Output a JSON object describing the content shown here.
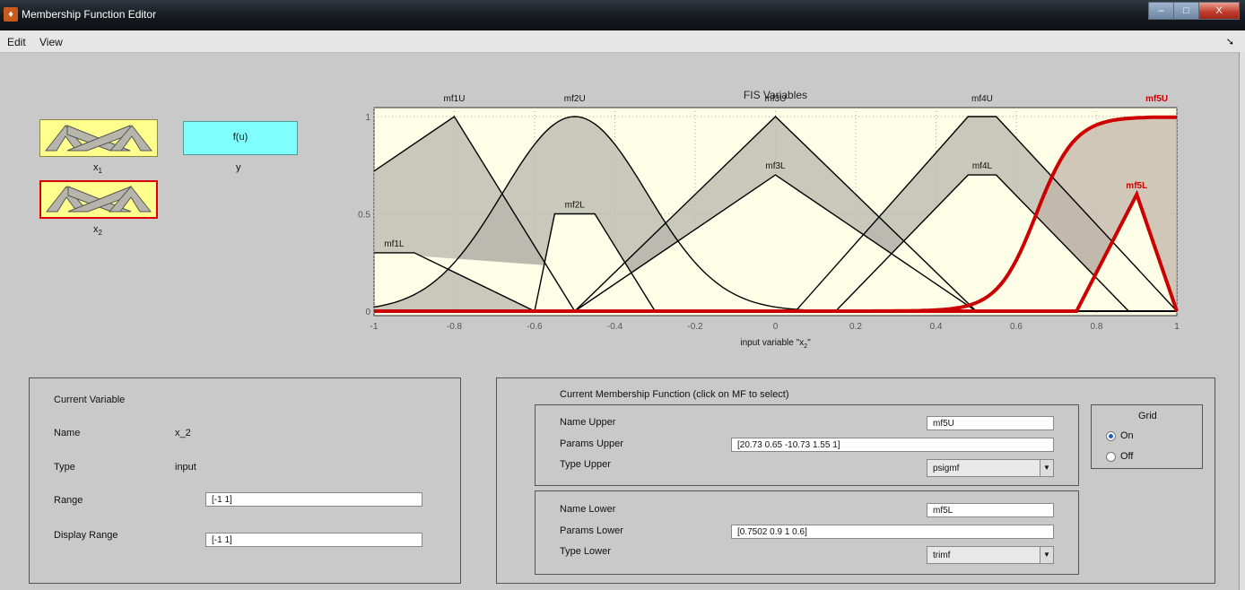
{
  "window": {
    "title": "Membership Function Editor",
    "minimize_label": "–",
    "maximize_label": "□",
    "close_label": "X"
  },
  "menu": {
    "edit": "Edit",
    "view": "View"
  },
  "fis_diagram": {
    "inputs": [
      {
        "name": "x",
        "subscript": "1"
      },
      {
        "name": "x",
        "subscript": "2"
      }
    ],
    "output": {
      "block_label": "f(u)",
      "name": "y"
    }
  },
  "plot": {
    "title": "FIS Variables",
    "xlabel_prefix": "input variable \"x",
    "xlabel_sub": "2",
    "xlabel_suffix": "\"",
    "xlim": [
      -1,
      1
    ],
    "ylim": [
      0,
      1
    ],
    "xticks": [
      "-1",
      "-0.8",
      "-0.6",
      "-0.4",
      "-0.2",
      "0",
      "0.2",
      "0.4",
      "0.6",
      "0.8",
      "1"
    ],
    "yticks": [
      "0",
      "0.5",
      "1"
    ],
    "grid": "on",
    "colors": {
      "background": "#ffffe8",
      "fill": "#b5b5ac",
      "line": "#000000",
      "selected": "#cc0000",
      "selected_fill": "#c0b4a8"
    }
  },
  "chart_data": {
    "type": "line",
    "title": "FIS Variables",
    "xlabel": "input variable \"x_2\"",
    "xlim": [
      -1,
      1
    ],
    "ylim": [
      0,
      1
    ],
    "grid": true,
    "series": [
      {
        "name": "mf1U",
        "points": [
          [
            -1,
            0.72
          ],
          [
            -0.8,
            1
          ],
          [
            -0.5,
            0
          ]
        ]
      },
      {
        "name": "mf1L",
        "points": [
          [
            -1,
            0.3
          ],
          [
            -0.9,
            0.3
          ],
          [
            -0.6,
            0
          ]
        ]
      },
      {
        "name": "mf2U",
        "shape": "gaussian",
        "center": -0.5,
        "sigma": 0.18,
        "peak": 1
      },
      {
        "name": "mf2L",
        "points": [
          [
            -0.6,
            0
          ],
          [
            -0.55,
            0.5
          ],
          [
            -0.45,
            0.5
          ],
          [
            -0.3,
            0
          ]
        ]
      },
      {
        "name": "mf3U",
        "points": [
          [
            -0.5,
            0
          ],
          [
            0,
            1
          ],
          [
            0.5,
            0
          ]
        ]
      },
      {
        "name": "mf3L",
        "points": [
          [
            -0.5,
            0
          ],
          [
            0,
            0.7
          ],
          [
            0.5,
            0
          ]
        ]
      },
      {
        "name": "mf4U",
        "points": [
          [
            0.05,
            0
          ],
          [
            0.48,
            1
          ],
          [
            0.55,
            1
          ],
          [
            1,
            0
          ]
        ]
      },
      {
        "name": "mf4L",
        "points": [
          [
            0.15,
            0
          ],
          [
            0.48,
            0.7
          ],
          [
            0.55,
            0.7
          ],
          [
            0.88,
            0
          ]
        ]
      },
      {
        "name": "mf5U",
        "shape": "psigmf",
        "params": [
          20.73,
          0.65,
          -10.73,
          1.55
        ],
        "selected": true
      },
      {
        "name": "mf5L",
        "points": [
          [
            0.7502,
            0
          ],
          [
            0.9,
            0.6
          ],
          [
            1,
            0
          ]
        ],
        "selected": true
      }
    ]
  },
  "current_variable": {
    "section_title": "Current Variable",
    "name_label": "Name",
    "name_value": "x_2",
    "type_label": "Type",
    "type_value": "input",
    "range_label": "Range",
    "range_value": "[-1 1]",
    "display_range_label": "Display Range",
    "display_range_value": "[-1 1]"
  },
  "current_mf": {
    "section_title": "Current Membership Function (click on MF to select)",
    "upper": {
      "name_label": "Name Upper",
      "name_value": "mf5U",
      "params_label": "Params Upper",
      "params_value": "[20.73 0.65 -10.73 1.55 1]",
      "type_label": "Type Upper",
      "type_value": "psigmf"
    },
    "lower": {
      "name_label": "Name Lower",
      "name_value": "mf5L",
      "params_label": "Params Lower",
      "params_value": "[0.7502 0.9 1 0.6]",
      "type_label": "Type Lower",
      "type_value": "trimf"
    }
  },
  "grid_control": {
    "title": "Grid",
    "on_label": "On",
    "off_label": "Off",
    "selected": "On"
  }
}
